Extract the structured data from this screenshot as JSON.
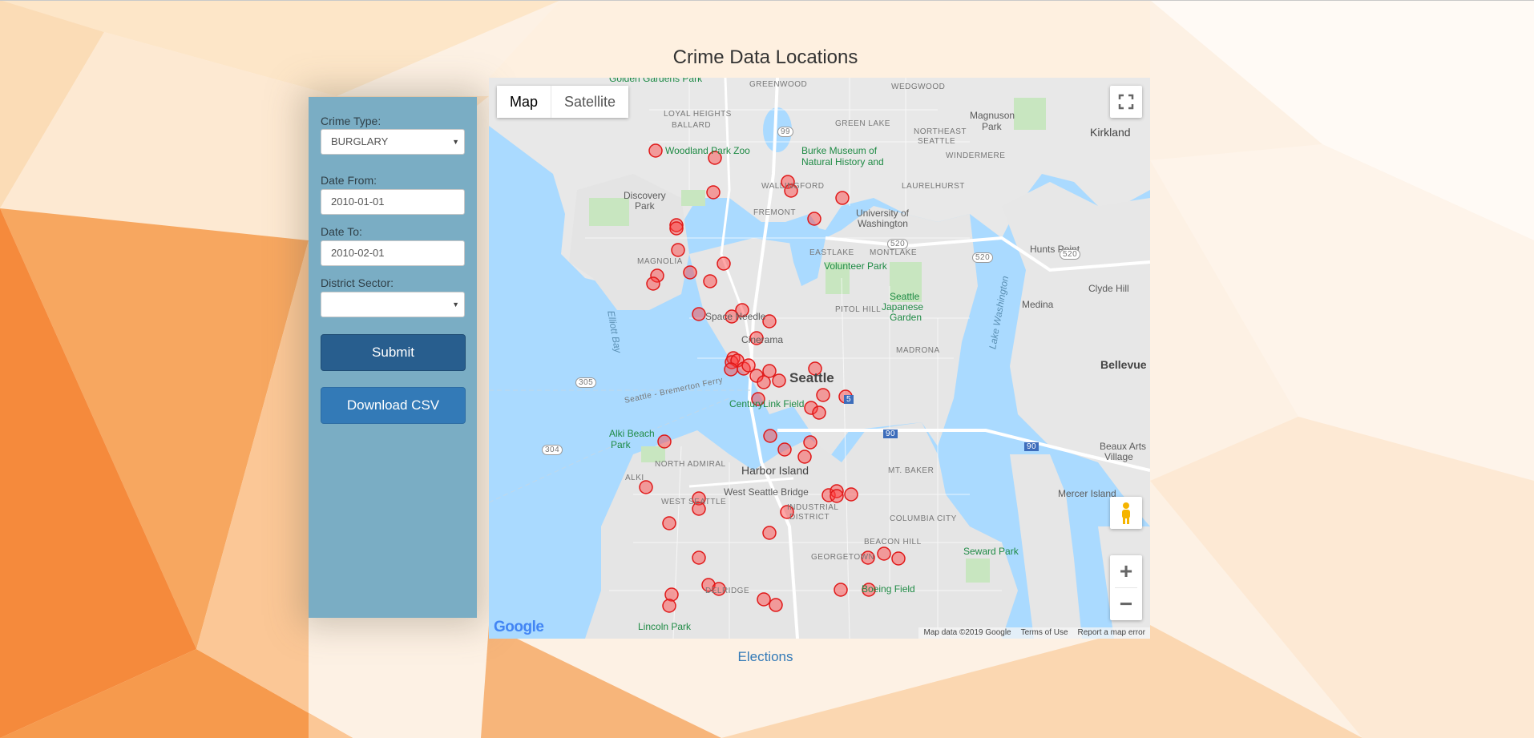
{
  "page": {
    "title": "Crime Data Locations",
    "footer_link": "Elections"
  },
  "form": {
    "crime_type_label": "Crime Type:",
    "crime_type_value": "BURGLARY",
    "date_from_label": "Date From:",
    "date_from_value": "2010-01-01",
    "date_to_label": "Date To:",
    "date_to_value": "2010-02-01",
    "district_label": "District Sector:",
    "district_value": "",
    "submit_label": "Submit",
    "download_label": "Download CSV"
  },
  "map": {
    "type_buttons": [
      "Map",
      "Satellite"
    ],
    "active_type": "Map",
    "logo": "Google",
    "attribution": [
      "Map data ©2019 Google",
      "Terms of Use",
      "Report a map error"
    ],
    "zoom_in": "+",
    "zoom_out": "−",
    "marker_color": "#ff3b3b",
    "labels": {
      "golden_gardens": "Golden Gardens Park",
      "greenwood": "GREENWOOD",
      "loyal_heights": "LOYAL HEIGHTS",
      "ballard": "BALLARD",
      "green_lake": "GREEN LAKE",
      "wedgwood": "WEDGWOOD",
      "magnuson": "Magnuson",
      "magnuson_park": "Park",
      "northeast_seattle": "NORTHEAST",
      "northeast_seattle_2": "SEATTLE",
      "kirkland": "Kirkland",
      "woodland_park": "Woodland Park Zoo",
      "burke_museum": "Burke Museum of",
      "burke_museum_2": "Natural History and",
      "windermere": "WINDERMERE",
      "wallingford": "WALLINGFORD",
      "laurelhurst": "LAURELHURST",
      "discovery_park": "Discovery",
      "discovery_park_2": "Park",
      "fremont": "FREMONT",
      "university": "University of",
      "university_2": "Washington",
      "hunts_point": "Hunts Point",
      "magnolia": "MAGNOLIA",
      "eastlake": "EASTLAKE",
      "montlake": "MONTLAKE",
      "volunteer_park": "Volunteer Park",
      "clyde_hill": "Clyde Hill",
      "capitol_hill": "PITOL HILL",
      "seattle_garden": "Seattle",
      "seattle_garden_2": "Japanese",
      "seattle_garden_3": "Garden",
      "medina": "Medina",
      "space_needle": "Space Needle",
      "lake_washington": "Lake Washington",
      "elliott_bay": "Elliott Bay",
      "cinerama": "Cinerama",
      "madrona": "MADRONA",
      "bellevue": "Bellevue",
      "seattle": "Seattle",
      "ferry": "Seattle - Bremerton Ferry",
      "centurylink": "CenturyLink Field",
      "alki_beach": "Alki Beach",
      "alki_beach_2": "Park",
      "beaux_arts": "Beaux Arts",
      "beaux_arts_2": "Village",
      "north_admiral": "NORTH ADMIRAL",
      "harbor_island": "Harbor Island",
      "alki": "ALKI",
      "mt_baker": "MT. BAKER",
      "west_seattle_bridge": "West Seattle Bridge",
      "mercer_island": "Mercer Island",
      "west_seattle": "WEST SEATTLE",
      "industrial": "INDUSTRIAL",
      "industrial_2": "DISTRICT",
      "columbia_city": "COLUMBIA CITY",
      "beacon_hill": "BEACON HILL",
      "seward_park": "Seward Park",
      "georgetown": "GEORGETOWN",
      "boeing_field": "Boeing Field",
      "delridge": "DELRIDGE",
      "lincoln_park": "Lincoln Park",
      "hwy_99": "99",
      "hwy_520a": "520",
      "hwy_520b": "520",
      "hwy_520c": "520",
      "hwy_305": "305",
      "hwy_304": "304",
      "hwy_5": "5",
      "hwy_90": "90",
      "hwy_90b": "90"
    }
  }
}
